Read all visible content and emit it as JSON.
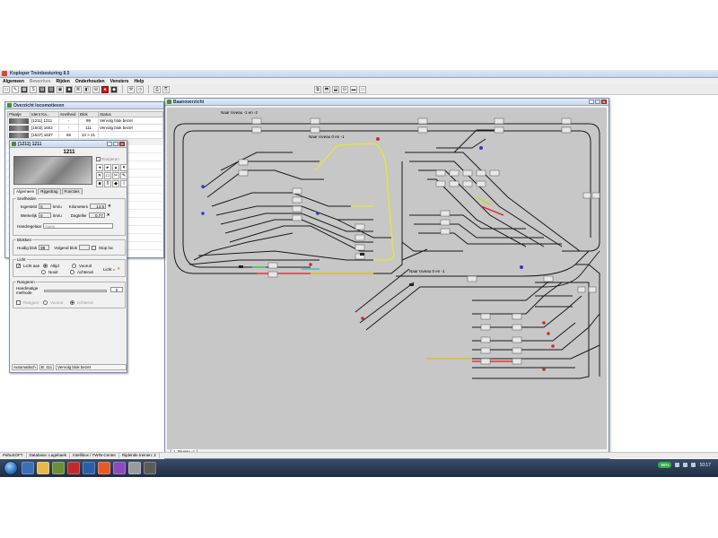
{
  "app": {
    "title": "Koploper Treinbesturing 8.5"
  },
  "menu": [
    {
      "label": "Algemeen",
      "disabled": false
    },
    {
      "label": "Bewerken",
      "disabled": true
    },
    {
      "label": "Rijden",
      "disabled": false
    },
    {
      "label": "Onderhouden",
      "disabled": false
    },
    {
      "label": "Vensters",
      "disabled": false
    },
    {
      "label": "Help",
      "disabled": false
    }
  ],
  "loco_overview": {
    "title": "Overzicht locomotieven",
    "columns": [
      "Plaatje",
      "Ident Ka...",
      "Snelheid",
      "Blok",
      "Status"
    ],
    "rows": [
      [
        "",
        "[1211] 1211",
        "-",
        "99",
        "Vervolg blok bezet"
      ],
      [
        "",
        "[1602] 1602",
        "-",
        "111",
        "Vervolg blok bezet"
      ],
      [
        "",
        "[1637] 1637",
        "66",
        "13 > 21",
        ""
      ]
    ]
  },
  "loco_detail": {
    "title": "[1211] 1211",
    "name": "1211",
    "tabs": [
      "Algemeen",
      "Rijgedrag",
      "Functies"
    ],
    "right_checkbox_label": "Rangeren",
    "speeds": {
      "label": "Snelheden",
      "ingesteld_label": "Ingesteld",
      "ingesteld_value": "0",
      "unit": "km/u",
      "werkelijk_label": "Werkelijk",
      "werkelijk_value": "0",
      "kilometers_label": "Kilometers",
      "kilometers_value": "14.5",
      "dagteller_label": "Dagteller",
      "dagteller_value": "0.77",
      "handregelaar_label": "Handregelaar",
      "handregelaar_value": "Geen"
    },
    "blocks": {
      "label": "Blokken",
      "huidig_label": "Huidig blok",
      "huidig_value": "99",
      "volgend_label": "Volgend blok",
      "volgend_value": "",
      "stop_label": "Stop loc"
    },
    "light": {
      "label": "Licht",
      "licht_aan": "Licht aan",
      "altijd": "Altijd",
      "vooruit": "Vooruit",
      "nooit": "Nooit",
      "achteruit": "Achteruit",
      "licht_eq": "Licht ="
    },
    "shunting": {
      "label": "Rangeren",
      "handmatige": "Handmatige",
      "methode": "methode",
      "value": "0",
      "opt1": "Rangeer",
      "opt2": "Vooruit",
      "opt3": "Achteruit"
    },
    "status": {
      "mode": "Automatisch",
      "block": "B: 111",
      "message": "Vervolg blok bezet"
    }
  },
  "rail": {
    "title": "Baanoverzicht",
    "labels": {
      "top_level": "Naar niveau -1 en -2",
      "mid_level": "Naar niveau 0 en -1",
      "low_level": "Naar niveau 0 en -1"
    },
    "tab": "1. Niveau -1"
  },
  "statusbar": [
    "PahuSOFT",
    "Database: Lagebaek",
    "Intellibox / TWIN-Center",
    "Rijdende treinen: 2"
  ],
  "tray": {
    "battery": "96%",
    "time": "10:17"
  }
}
